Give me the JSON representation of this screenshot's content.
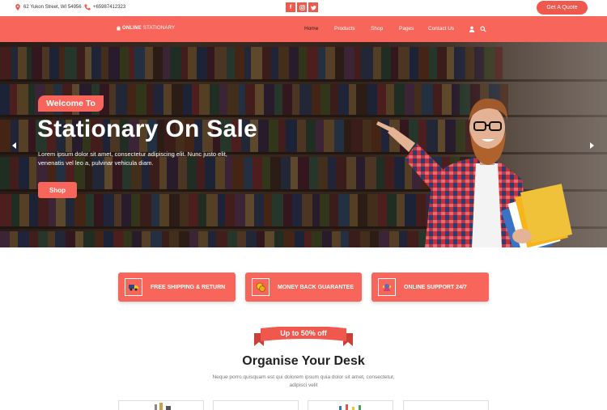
{
  "topbar": {
    "address": "62 Yukon Street, WI 54956",
    "phone": "+65987412323",
    "social": [
      "f",
      "ig",
      "t"
    ],
    "quote_button": "Get A Quote"
  },
  "nav": {
    "logo_bold": "ONLINE",
    "logo_rest": "STATIONARY",
    "links": [
      "Home",
      "Products",
      "Shop",
      "Pages",
      "Contact Us"
    ],
    "active_link": "Home",
    "icons": [
      "user-icon",
      "search-icon"
    ]
  },
  "hero": {
    "badge": "Welcome To",
    "title": "Stationary On Sale",
    "text": "Lorem ipsum dolor sit amet, consectetur adipiscing elit. Nunc justo elit, venenatis vel leo a, pulvinar vehicula diam.",
    "button": "Shop",
    "prev_arrow": "‹",
    "next_arrow": "›"
  },
  "features": [
    {
      "label": "FREE SHIPPING & RETURN",
      "icon": "truck-icon"
    },
    {
      "label": "MONEY BACK GUARANTEE",
      "icon": "coins-icon"
    },
    {
      "label": "ONLINE SUPPORT 24/7",
      "icon": "support-icon"
    }
  ],
  "promo": {
    "ribbon": "Up to 50% off",
    "title": "Organise Your Desk",
    "subtitle": "Neque porro quisquam est qui dolorem ipsum quia dolor sit amet, consectetur, adipisci velit"
  },
  "colors": {
    "accent": "#f8665b",
    "accent_dark": "#f0584e"
  }
}
